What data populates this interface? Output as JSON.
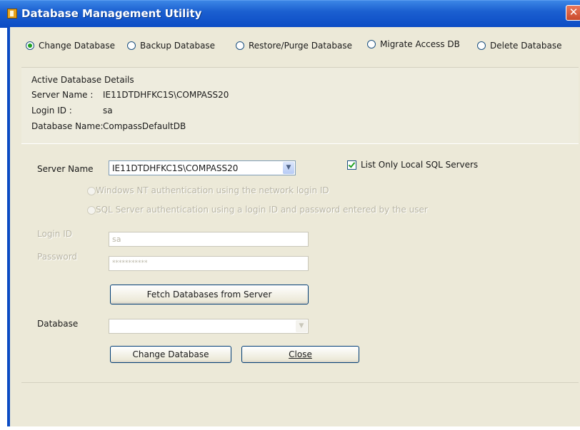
{
  "window": {
    "title": "Database Management Utility",
    "close_glyph": "✕"
  },
  "operations": [
    {
      "label": "Change Database",
      "selected": true
    },
    {
      "label": "Backup Database",
      "selected": false
    },
    {
      "label": "Restore/Purge Database",
      "selected": false
    },
    {
      "label": "Migrate Access DB",
      "selected": false
    },
    {
      "label": "Delete Database",
      "selected": false
    }
  ],
  "active_details": {
    "heading": "Active Database Details",
    "server_label": "Server Name :",
    "server_value": "IE11DTDHFKC1S\\COMPASS20",
    "login_label": "Login ID :",
    "login_value": "sa",
    "db_label": "Database  Name:",
    "db_value": "CompassDefaultDB"
  },
  "form": {
    "server_label": "Server Name",
    "server_value": "IE11DTDHFKC1S\\COMPASS20",
    "list_local_label": "List Only Local SQL Servers",
    "list_local_checked": true,
    "auth_windows": "Windows NT authentication using the network login ID",
    "auth_sql": "SQL Server authentication using a login ID and password entered by the user",
    "login_label": "Login ID",
    "login_value": "sa",
    "password_label": "Password",
    "password_value": "***********",
    "fetch_button": "Fetch Databases from Server",
    "database_label": "Database",
    "database_value": "",
    "change_button": "Change Database",
    "close_button": "Close"
  },
  "colors": {
    "titlebar": "#0b4bc4",
    "window_bg": "#ece9d8",
    "radio_check": "#21a121"
  }
}
